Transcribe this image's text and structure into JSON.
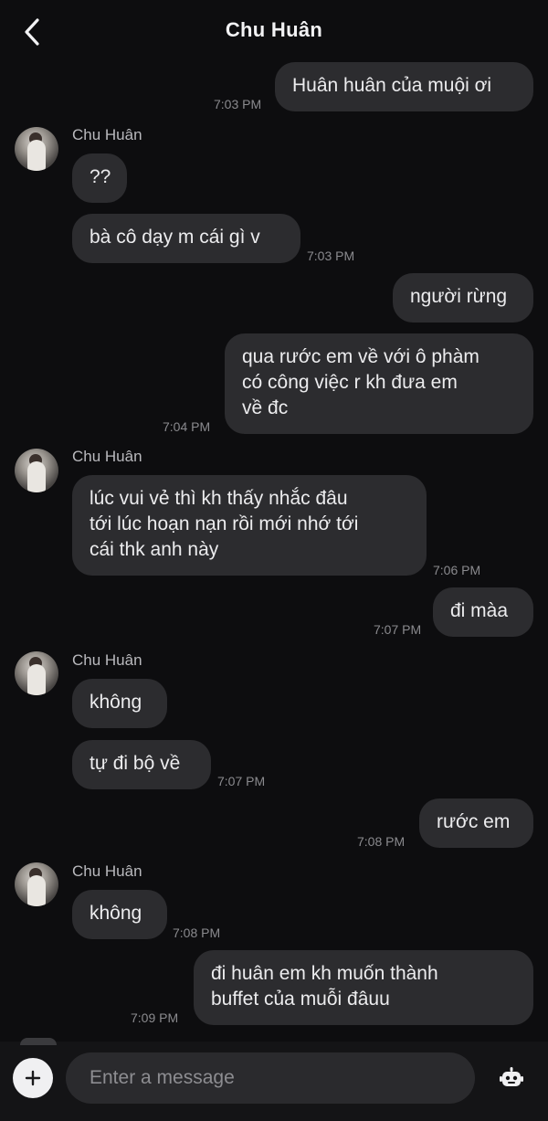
{
  "header": {
    "title": "Chu Huân"
  },
  "contact_name": "Chu Huân",
  "messages": [
    {
      "text": "Huân huân của muội ơi",
      "time": "7:03 PM"
    },
    {
      "text": "??"
    },
    {
      "text": "bà cô dạy m cái gì v",
      "time": "7:03 PM"
    },
    {
      "text": "người rừng"
    },
    {
      "text": "qua rước em về với ô phàm\ncó công việc r kh đưa em\nvề đc",
      "time": "7:04 PM"
    },
    {
      "text": "lúc vui vẻ thì kh thấy nhắc đâu\ntới lúc hoạn nạn rồi mới nhớ tới\ncái thk anh này",
      "time": "7:06 PM"
    },
    {
      "text": "đi màa",
      "time": "7:07 PM"
    },
    {
      "text": "không"
    },
    {
      "text": "tự đi bộ về",
      "time": "7:07 PM"
    },
    {
      "text": "rước em",
      "time": "7:08 PM"
    },
    {
      "text": "không",
      "time": "7:08 PM"
    },
    {
      "text": "đi huân em kh muốn thành\nbuffet của muỗi đâuu",
      "time": "7:09 PM"
    }
  ],
  "composer": {
    "placeholder": "Enter a message"
  },
  "colors": {
    "background": "#0d0d0f",
    "bubble": "#2c2c2f",
    "text": "#ececee",
    "timestamp": "#8a8a8e"
  },
  "icons": {
    "back": "chevron-left-icon",
    "add": "plus-icon",
    "bot": "robot-icon"
  }
}
